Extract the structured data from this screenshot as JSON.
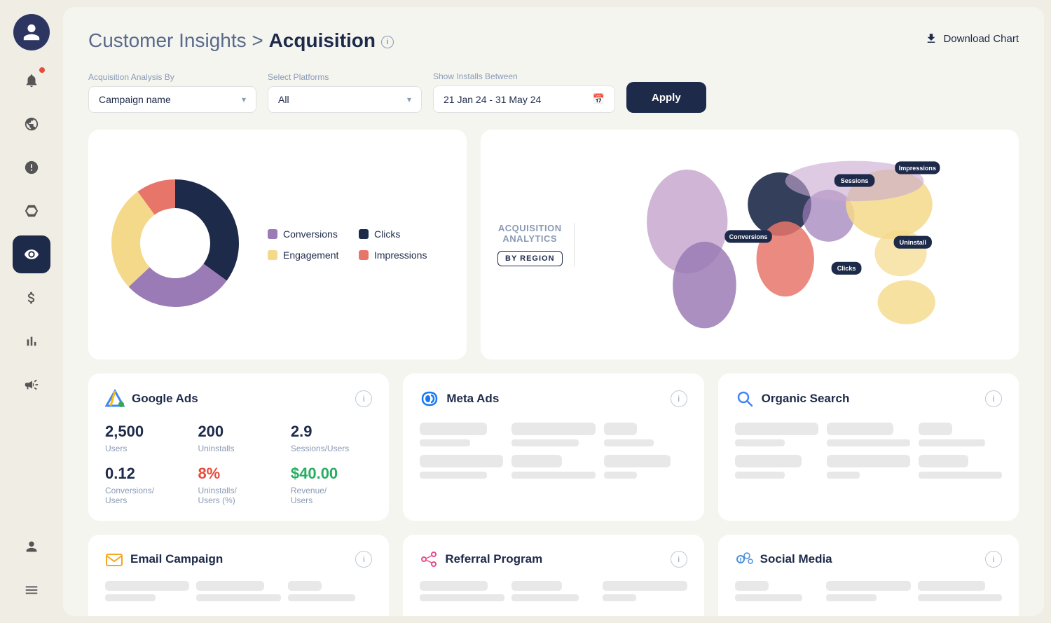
{
  "sidebar": {
    "items": [
      {
        "name": "notifications",
        "label": "Notifications",
        "active": false,
        "badge": true
      },
      {
        "name": "block",
        "label": "Block",
        "active": false
      },
      {
        "name": "user-alert",
        "label": "User Alert",
        "active": false
      },
      {
        "name": "hexagon",
        "label": "Hexagon",
        "active": false
      },
      {
        "name": "eye",
        "label": "Eye",
        "active": true
      },
      {
        "name": "dollar",
        "label": "Dollar",
        "active": false
      },
      {
        "name": "chart",
        "label": "Chart",
        "active": false
      },
      {
        "name": "megaphone",
        "label": "Megaphone",
        "active": false
      },
      {
        "name": "user",
        "label": "User",
        "active": false
      },
      {
        "name": "menu",
        "label": "Menu",
        "active": false
      }
    ]
  },
  "header": {
    "breadcrumb_prefix": "Customer Insights > ",
    "title": "Acquisition",
    "info_label": "i",
    "download_label": "Download Chart"
  },
  "filters": {
    "analysis_label": "Acquisition Analysis By",
    "analysis_value": "Campaign name",
    "platforms_label": "Select Platforms",
    "platforms_value": "All",
    "date_label": "Show Installs Between",
    "date_value": "21 Jan 24 - 31 May 24",
    "apply_label": "Apply"
  },
  "donut": {
    "legend": [
      {
        "label": "Conversions",
        "color": "#9b7bb5"
      },
      {
        "label": "Clicks",
        "color": "#1e2a4a"
      },
      {
        "label": "Engagement",
        "color": "#f5d98a"
      },
      {
        "label": "Impressions",
        "color": "#e8756a"
      }
    ]
  },
  "map": {
    "title1": "ACQUISITION",
    "title2": "ANALYTICS",
    "badge": "BY REGION",
    "tooltips": [
      {
        "label": "Sessions",
        "x": "67%",
        "y": "18%"
      },
      {
        "label": "Conversions",
        "x": "32%",
        "y": "36%"
      },
      {
        "label": "Impressions",
        "x": "82%",
        "y": "12%"
      },
      {
        "label": "Clicks",
        "x": "63%",
        "y": "52%"
      },
      {
        "label": "Uninstall",
        "x": "76%",
        "y": "40%"
      }
    ]
  },
  "google_ads": {
    "title": "Google Ads",
    "info": "i",
    "metrics": [
      {
        "value": "2,500",
        "unit": "Users",
        "style": "normal"
      },
      {
        "value": "200",
        "unit": "Uninstalls",
        "style": "normal"
      },
      {
        "value": "2.9",
        "unit": "Sessions/Users",
        "style": "normal"
      },
      {
        "value": "0.12",
        "unit": "Conversions/\nUsers",
        "style": "normal"
      },
      {
        "value": "8%",
        "unit": "Uninstalls/\nUsers (%)",
        "style": "red"
      },
      {
        "value": "$40.00",
        "unit": "Revenue/\nUsers",
        "style": "green"
      }
    ]
  },
  "meta_ads": {
    "title": "Meta Ads",
    "info": "i"
  },
  "organic_search": {
    "title": "Organic Search",
    "info": "i"
  },
  "email_campaign": {
    "title": "Email Campaign",
    "info": "i"
  },
  "referral_program": {
    "title": "Referral Program",
    "info": "i"
  },
  "social_media": {
    "title": "Social Media",
    "info": "i"
  }
}
